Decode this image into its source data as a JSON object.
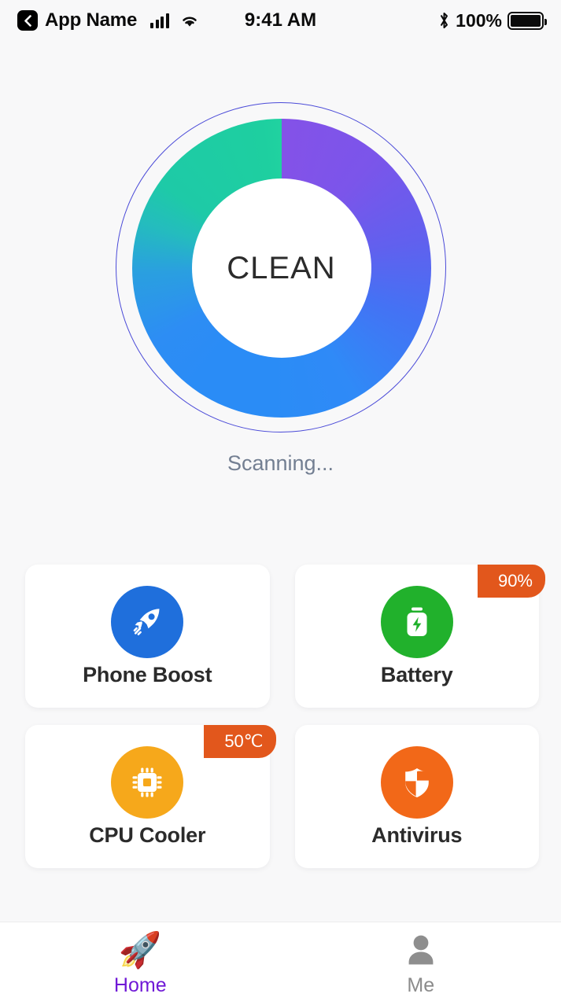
{
  "statusbar": {
    "back_icon": "chevron-left-icon",
    "app_name": "App Name",
    "signal_icon": "cellular-signal-icon",
    "wifi_icon": "wifi-icon",
    "time": "9:41 AM",
    "bluetooth_icon": "bluetooth-icon",
    "battery_percent": "100%",
    "battery_icon": "battery-full-icon"
  },
  "scan": {
    "center_label": "CLEAN",
    "status_text": "Scanning...",
    "ring_colors": {
      "teal": "#1ecaa7",
      "purple": "#8452e8",
      "blue": "#2a8cf6",
      "outline": "#4a4ad8"
    }
  },
  "features": [
    {
      "id": "phone-boost",
      "label": "Phone Boost",
      "icon": "rocket-icon",
      "icon_color": "#1f6fdc",
      "badge": null
    },
    {
      "id": "battery",
      "label": "Battery",
      "icon": "battery-bolt-icon",
      "icon_color": "#21b12c",
      "badge": "90%",
      "badge_color": "#e2571c"
    },
    {
      "id": "cpu-cooler",
      "label": "CPU Cooler",
      "icon": "cpu-chip-icon",
      "icon_color": "#f6a81b",
      "badge": "50℃",
      "badge_color": "#e2571c"
    },
    {
      "id": "antivirus",
      "label": "Antivirus",
      "icon": "shield-icon",
      "icon_color": "#f26818",
      "badge": null
    }
  ],
  "tabbar": [
    {
      "id": "home",
      "label": "Home",
      "icon": "rocket-emoji-icon",
      "active": true,
      "color": "#7019d6"
    },
    {
      "id": "me",
      "label": "Me",
      "icon": "person-icon",
      "active": false,
      "color": "#8b8b8b"
    }
  ]
}
